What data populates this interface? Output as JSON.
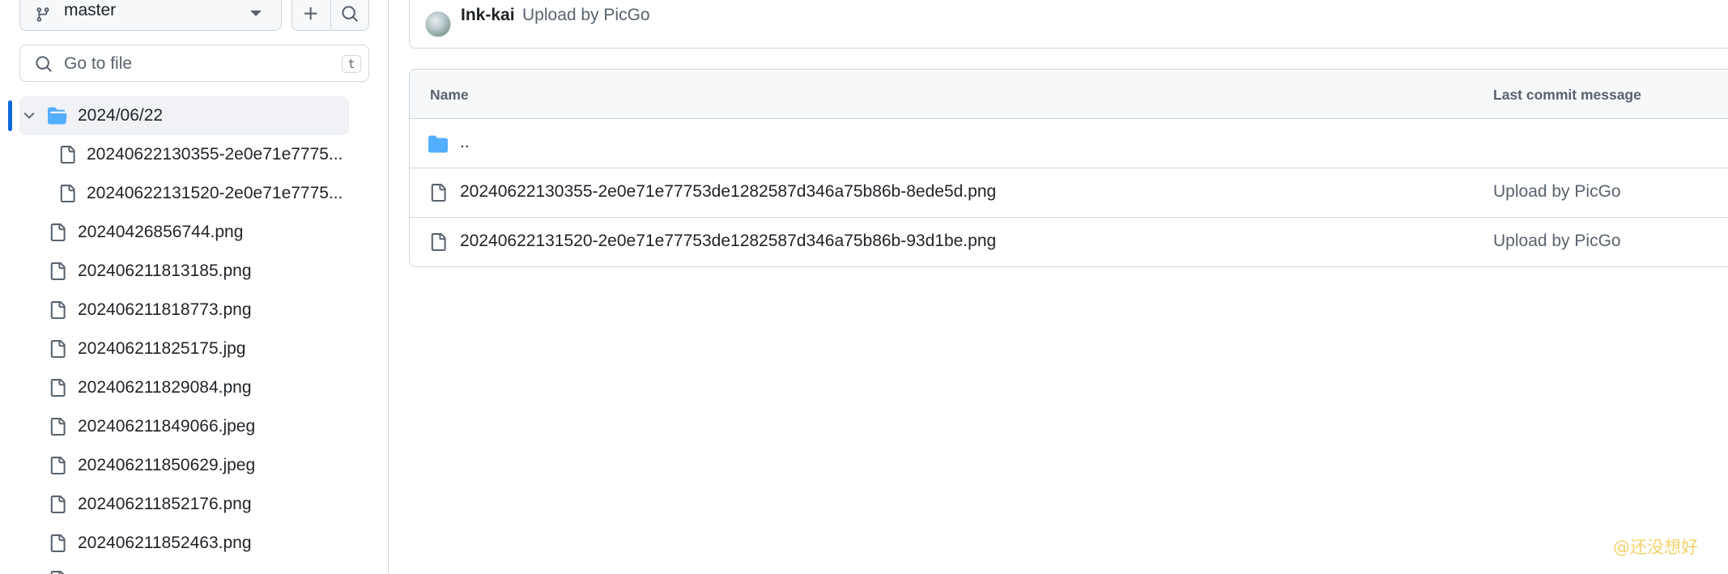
{
  "branch": {
    "name": "master"
  },
  "toolbar": {
    "add_icon": "plus-icon",
    "search_icon": "search-icon"
  },
  "file_search": {
    "placeholder": "Go to file",
    "shortcut": "t"
  },
  "tree": {
    "selected_folder": "2024/06/22",
    "children": [
      "20240622130355-2e0e71e7775...",
      "20240622131520-2e0e71e7775..."
    ],
    "files": [
      "20240426856744.png",
      "202406211813185.png",
      "202406211818773.png",
      "202406211825175.jpg",
      "202406211829084.png",
      "202406211849066.jpeg",
      "202406211850629.jpeg",
      "202406211852176.png",
      "202406211852463.png"
    ]
  },
  "latest_commit": {
    "author": "Ink-kai",
    "message": "Upload by PicGo"
  },
  "files_table": {
    "headers": {
      "name": "Name",
      "commit": "Last commit message"
    },
    "parent_label": "..",
    "rows": [
      {
        "name": "20240622130355-2e0e71e77753de1282587d346a75b86b-8ede5d.png",
        "commit": "Upload by PicGo"
      },
      {
        "name": "20240622131520-2e0e71e77753de1282587d346a75b86b-93d1be.png",
        "commit": "Upload by PicGo"
      }
    ]
  },
  "watermark": "@还没想好",
  "colors": {
    "accent": "#0969da",
    "folder": "#54aeff",
    "muted_text": "#59636e",
    "border": "#d0d7de",
    "watermark": "#f2d36a"
  }
}
